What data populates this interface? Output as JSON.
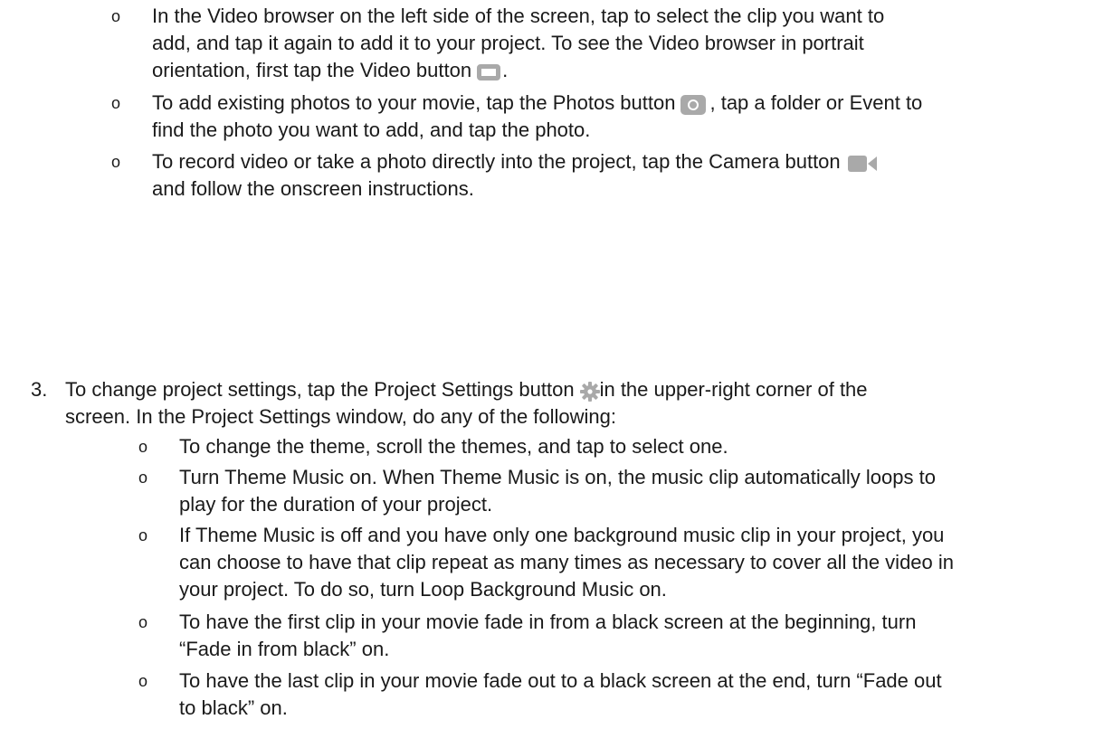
{
  "bullets_top": [
    {
      "marker": "o",
      "lines": [
        "In the Video browser on the left side of the screen, tap to select the clip you want to",
        "add, and tap it again to add it to your project. To see the Video browser in portrait",
        "orientation, first tap the Video button"
      ],
      "tail": ".",
      "icon": "video-frame-icon"
    },
    {
      "marker": "o",
      "line1_a": "To add existing photos to your movie, tap the Photos button",
      "line1_b": ", tap a folder or Event to",
      "line2": "find the photo you want to add, and tap the photo.",
      "icon": "camera-photo-icon"
    },
    {
      "marker": "o",
      "line1": "To record video or take a photo directly into the project, tap the Camera button",
      "line2": "and follow the onscreen instructions.",
      "icon": "video-camera-icon"
    }
  ],
  "step3": {
    "number": "3.",
    "line1_a": "To change project settings, tap the Project Settings button",
    "line1_b": "in the upper-right corner of the",
    "line2": "screen. In the Project Settings window, do any of the following:",
    "icon": "gear-icon",
    "items": [
      {
        "marker": "o",
        "lines": [
          "To change the theme, scroll the themes, and tap to select one."
        ]
      },
      {
        "marker": "o",
        "lines": [
          "Turn Theme Music on. When Theme Music is on, the music clip automatically loops to",
          "play for the duration of your project."
        ]
      },
      {
        "marker": "o",
        "lines": [
          "If Theme Music is off and you have only one background music clip in your project, you",
          "can choose to have that clip repeat as many times as necessary to cover all the video in",
          "your project. To do so, turn Loop Background Music on."
        ]
      },
      {
        "marker": "o",
        "lines": [
          "To have the first clip in your movie fade in from a black screen at the beginning, turn",
          "“Fade in from black” on."
        ]
      },
      {
        "marker": "o",
        "lines": [
          "To have the last clip in your movie fade out to a black screen at the end, turn “Fade out",
          "to black” on."
        ]
      }
    ]
  },
  "colors": {
    "icon_gray": "#a9a9a9",
    "text": "#1a1a1a"
  }
}
